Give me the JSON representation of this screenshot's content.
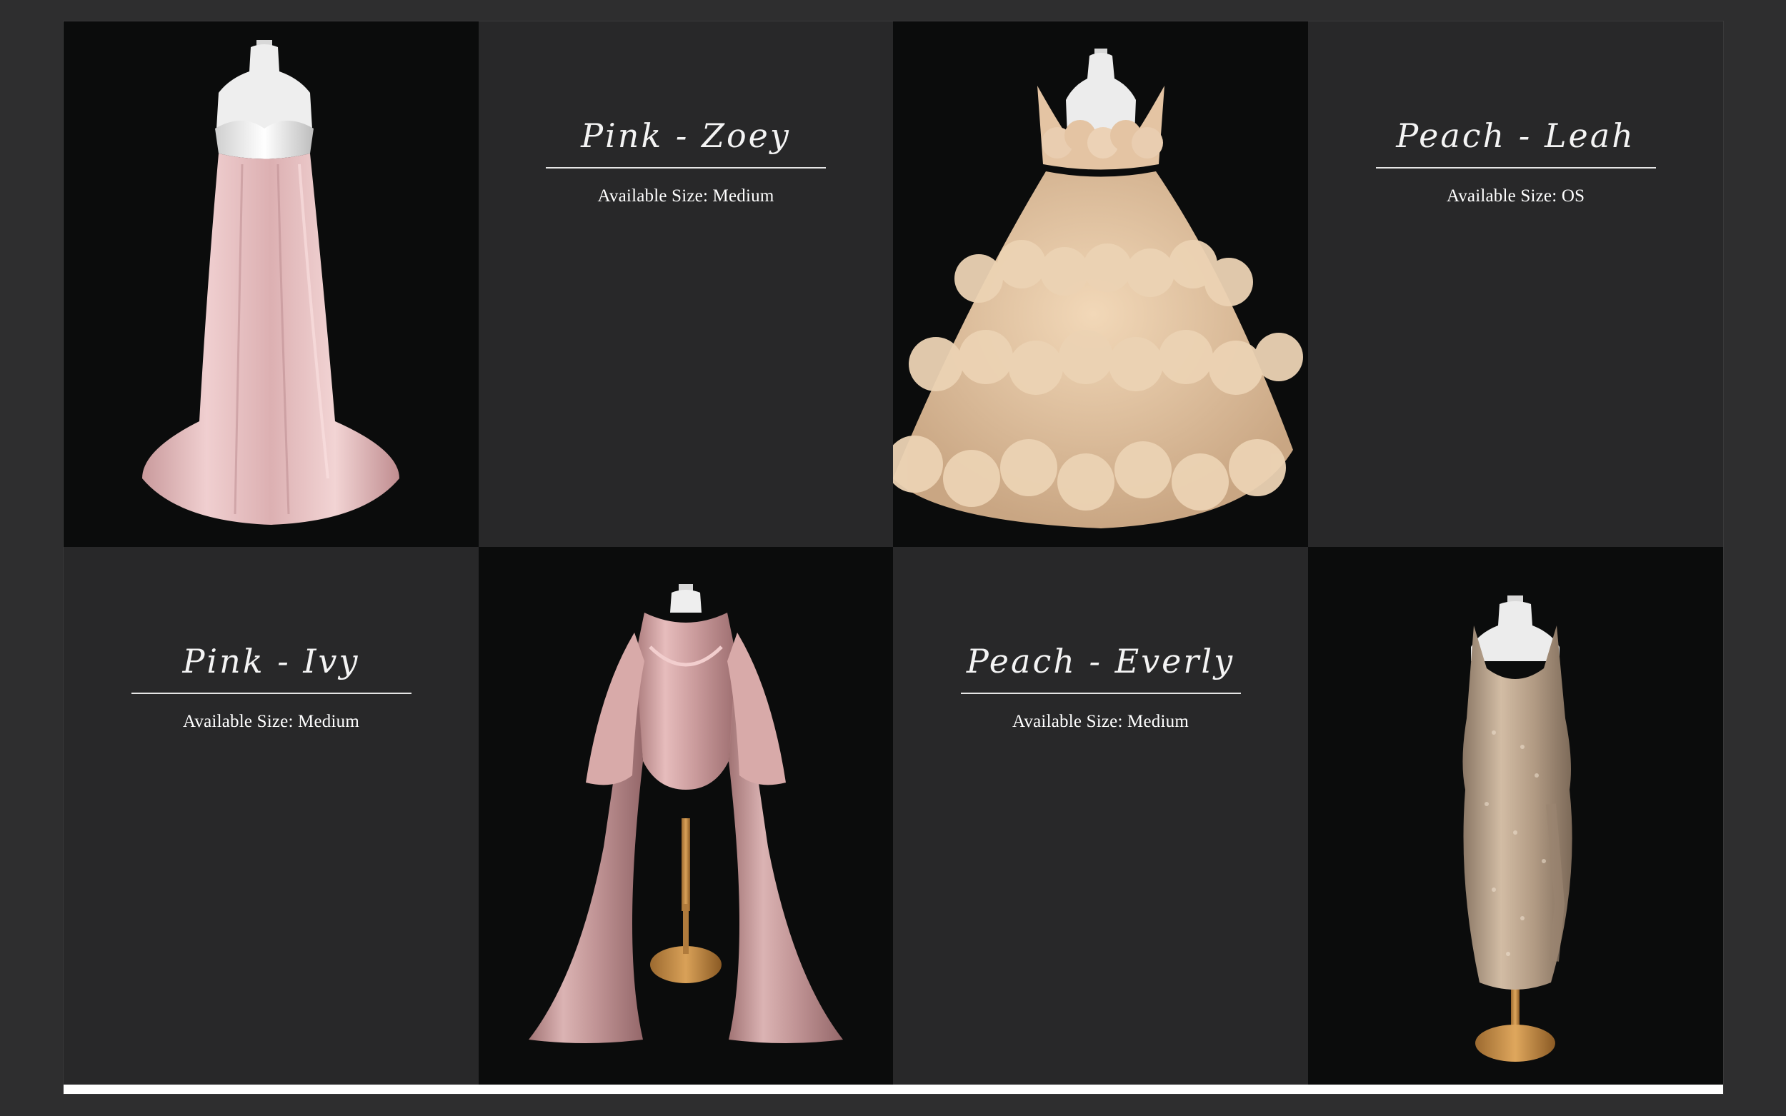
{
  "products": [
    {
      "title": "Pink - Zoey",
      "size_label": "Available Size: Medium",
      "image_icon": "pink-gown-image",
      "color": "#e9c3c3"
    },
    {
      "title": "Peach - Leah",
      "size_label": "Available Size: OS",
      "image_icon": "peach-ruffled-gown-image",
      "color": "#e7c6a2"
    },
    {
      "title": "Pink - Ivy",
      "size_label": "Available Size: Medium",
      "image_icon": "pink-satin-bodysuit-gown-image",
      "color": "#d8aaa4"
    },
    {
      "title": "Peach - Everly",
      "size_label": "Available Size: Medium",
      "image_icon": "champagne-sequin-dress-image",
      "color": "#c4ad95"
    }
  ],
  "colors": {
    "page_background": "#2e2e2f",
    "card_background": "#282829",
    "photo_background": "#0b0c0c",
    "text": "#ffffff"
  }
}
